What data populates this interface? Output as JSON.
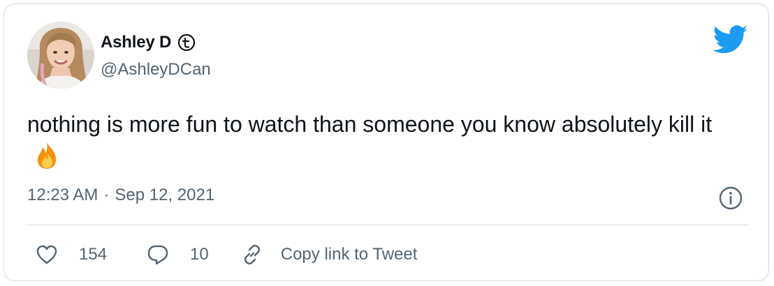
{
  "tweet": {
    "author": {
      "display_name": "Ashley D",
      "handle": "@AshleyDCan",
      "badge_icon": "topic-t-badge-icon",
      "avatar": "profile-photo"
    },
    "brand_icon": "twitter-bird-icon",
    "brand_color": "#1d9bf0",
    "text": "nothing is more fun to watch than someone you know absolutely kill it",
    "emoji_icon": "fire-emoji-icon",
    "time": "12:23 AM",
    "separator": "·",
    "date": "Sep 12, 2021",
    "info_icon": "info-icon",
    "actions": {
      "likes": {
        "icon": "heart-icon",
        "count": "154"
      },
      "replies": {
        "icon": "reply-bubble-icon",
        "count": "10"
      },
      "copy_link": {
        "icon": "link-icon",
        "label": "Copy link to Tweet"
      }
    },
    "colors": {
      "text_primary": "#0f1419",
      "text_secondary": "#536471",
      "border": "#cfd9de"
    }
  }
}
